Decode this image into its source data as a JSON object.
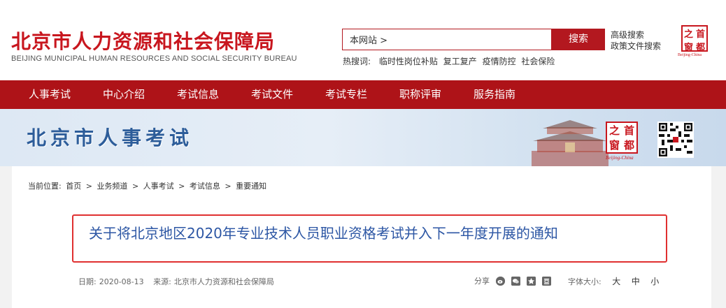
{
  "header": {
    "logo_cn": "北京市人力资源和社会保障局",
    "logo_en": "BEIJING MUNICIPAL HUMAN RESOURCES AND SOCIAL SECURITY BUREAU",
    "search_value": "本网站 >",
    "search_button": "搜索",
    "advanced_search": "高级搜索",
    "policy_search": "政策文件搜索",
    "hot_label": "热搜词:",
    "hot_words": [
      "临时性岗位补贴",
      "复工复产",
      "疫情防控",
      "社会保险"
    ],
    "stamp": [
      "之",
      "首",
      "窗",
      "都"
    ],
    "stamp_caption": "Beijing-China"
  },
  "nav": {
    "items": [
      "人事考试",
      "中心介绍",
      "考试信息",
      "考试文件",
      "考试专栏",
      "职称评审",
      "服务指南"
    ]
  },
  "banner": {
    "title": "北京市人事考试",
    "stamp": [
      "之",
      "首",
      "窗",
      "都"
    ],
    "stamp_caption": "Beijing-China"
  },
  "breadcrumb": {
    "label": "当前位置:",
    "items": [
      "首页",
      ">",
      "业务频道",
      ">",
      "人事考试",
      ">",
      "考试信息",
      ">",
      "重要通知"
    ]
  },
  "article": {
    "title": "关于将北京地区2020年专业技术人员职业资格考试并入下一年度开展的通知",
    "date_label": "日期:",
    "date": "2020-08-13",
    "source_label": "来源:",
    "source": "北京市人力资源和社会保障局",
    "share_label": "分享",
    "font_size_label": "字体大小:",
    "font_sizes": [
      "大",
      "中",
      "小"
    ]
  },
  "colors": {
    "brand_red": "#c8161e",
    "nav_red": "#ae1318",
    "title_blue": "#2c56a4",
    "banner_blue": "#2d5d9a",
    "highlight_border": "#e03030"
  },
  "icons": [
    "weibo-share-icon",
    "wechat-share-icon",
    "qzone-share-icon",
    "douban-share-icon"
  ]
}
